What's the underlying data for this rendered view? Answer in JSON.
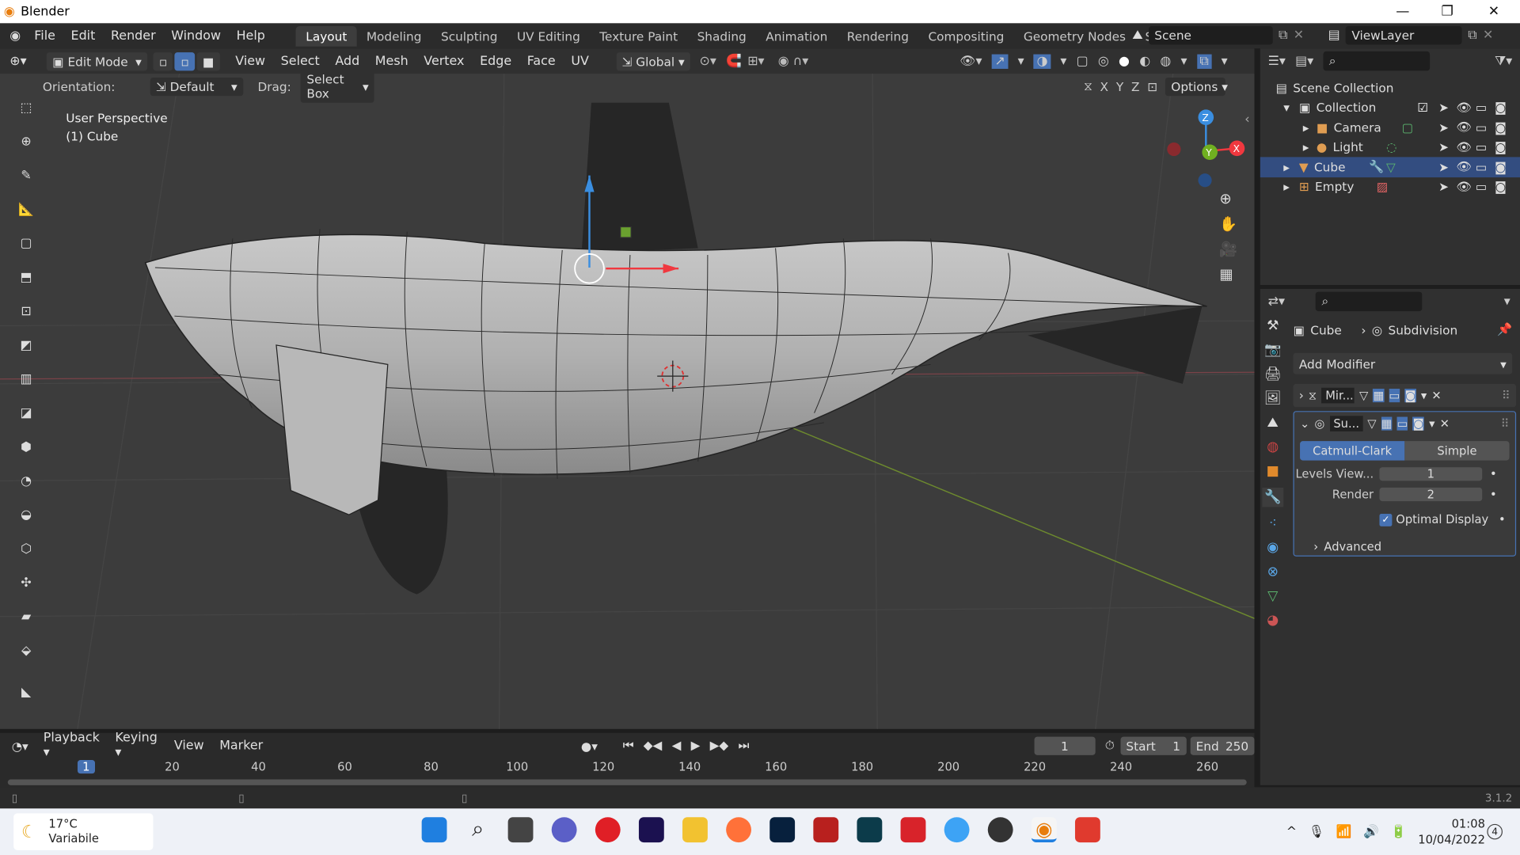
{
  "app": {
    "title": "Blender"
  },
  "menus": [
    "File",
    "Edit",
    "Render",
    "Window",
    "Help"
  ],
  "workspaces": [
    "Layout",
    "Modeling",
    "Sculpting",
    "UV Editing",
    "Texture Paint",
    "Shading",
    "Animation",
    "Rendering",
    "Compositing",
    "Geometry Nodes",
    "Scripting"
  ],
  "scene": {
    "name": "Scene",
    "viewlayer": "ViewLayer"
  },
  "header": {
    "mode": "Edit Mode",
    "menus": [
      "View",
      "Select",
      "Add",
      "Mesh",
      "Vertex",
      "Edge",
      "Face",
      "UV"
    ],
    "transform": "Global"
  },
  "toolsettings": {
    "orientation_label": "Orientation:",
    "orientation": "Default",
    "drag_label": "Drag:",
    "drag": "Select Box",
    "options": "Options",
    "axes": [
      "X",
      "Y",
      "Z"
    ]
  },
  "viewport": {
    "view_name": "User Perspective",
    "object_name": "(1) Cube"
  },
  "gizmo": {
    "z": "Z",
    "y": "Y",
    "x": "X"
  },
  "outliner": {
    "root": "Scene Collection",
    "items": [
      {
        "label": "Collection"
      },
      {
        "label": "Camera"
      },
      {
        "label": "Light"
      },
      {
        "label": "Cube"
      },
      {
        "label": "Empty"
      }
    ]
  },
  "properties": {
    "breadcrumb_object": "Cube",
    "breadcrumb_modifier": "Subdivision",
    "add_modifier": "Add Modifier",
    "modifiers": [
      {
        "short": "Mir..."
      },
      {
        "short": "Su..."
      }
    ],
    "subdiv": {
      "catmull": "Catmull-Clark",
      "simple": "Simple",
      "levels_label": "Levels View...",
      "levels": "1",
      "render_label": "Render",
      "render": "2",
      "optimal": "Optimal Display",
      "advanced": "Advanced"
    }
  },
  "timeline": {
    "menus": [
      "Playback",
      "Keying",
      "View",
      "Marker"
    ],
    "current_frame": "1",
    "start_label": "Start",
    "start": "1",
    "end_label": "End",
    "end": "250",
    "ticks": [
      "1",
      "20",
      "40",
      "60",
      "80",
      "100",
      "120",
      "140",
      "160",
      "180",
      "200",
      "220",
      "240",
      "260"
    ]
  },
  "status": {
    "version": "3.1.2"
  },
  "taskbar": {
    "temp": "17°C",
    "weather": "Variabile",
    "time": "01:08",
    "date": "10/04/2022",
    "badge": "4"
  },
  "colors": {
    "accent": "#4772b3",
    "bg": "#303030",
    "viewport": "#3c3c3c",
    "x_axis": "#f0383f",
    "y_axis": "#70b020",
    "z_axis": "#3a8ee0"
  }
}
